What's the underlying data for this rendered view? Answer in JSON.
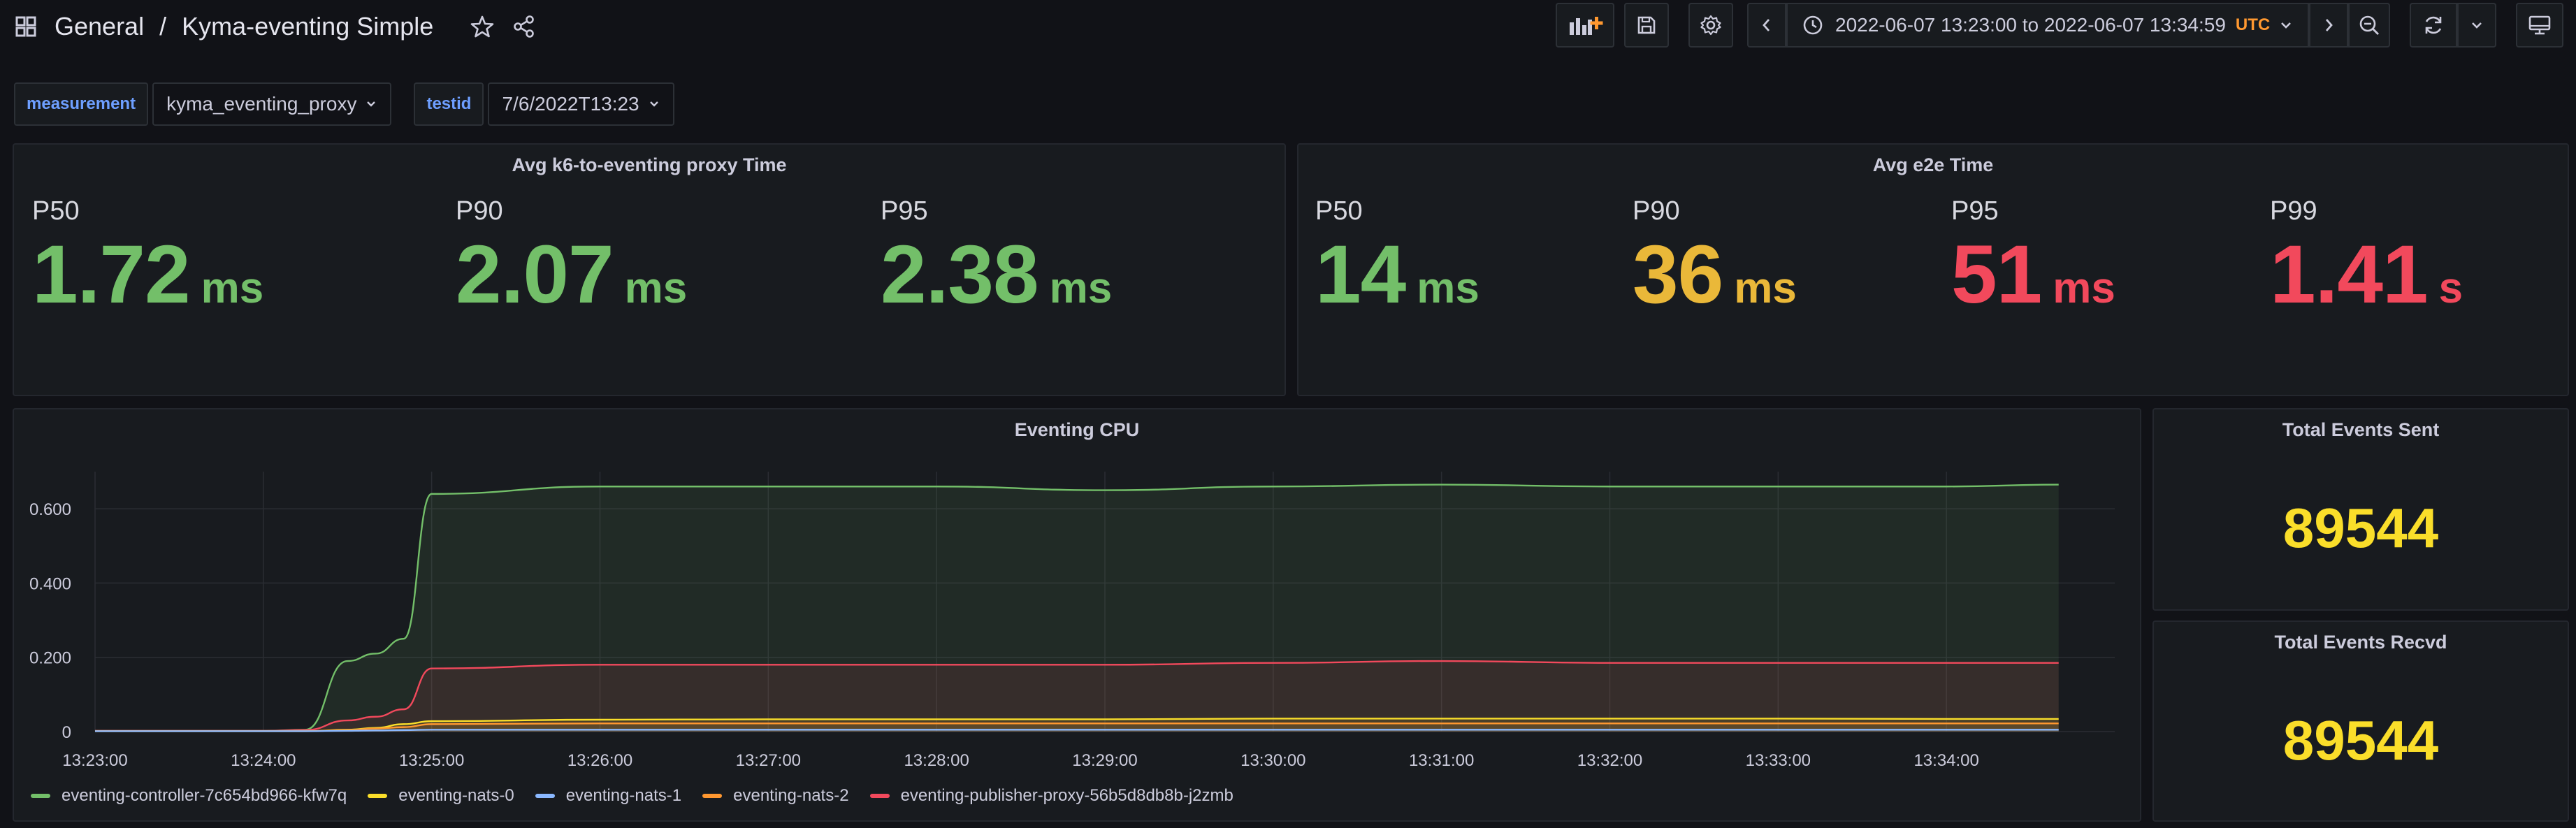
{
  "breadcrumb": {
    "folder": "General",
    "separator": "/",
    "dashboard": "Kyma-eventing Simple"
  },
  "time_picker": {
    "range": "2022-06-07 13:23:00 to 2022-06-07 13:34:59",
    "timezone": "UTC"
  },
  "icons": {
    "apps": "grid-icon",
    "star": "star-icon",
    "share": "share-icon",
    "add_panel": "add-panel-icon",
    "save": "save-icon",
    "settings": "gear-icon",
    "prev": "chevron-left-icon",
    "clock": "clock-icon",
    "next": "chevron-right-icon",
    "zoom_out": "zoom-out-icon",
    "refresh": "refresh-icon",
    "refresh_interval": "chevron-down-icon",
    "tv_mode": "monitor-icon"
  },
  "variables": [
    {
      "label": "measurement",
      "value": "kyma_eventing_proxy"
    },
    {
      "label": "testid",
      "value": "7/6/2022T13:23"
    }
  ],
  "panels": {
    "proxy_time": {
      "title": "Avg k6-to-eventing proxy Time",
      "stats": [
        {
          "label": "P50",
          "value": "1.72",
          "unit": "ms",
          "color": "#73bf69"
        },
        {
          "label": "P90",
          "value": "2.07",
          "unit": "ms",
          "color": "#73bf69"
        },
        {
          "label": "P95",
          "value": "2.38",
          "unit": "ms",
          "color": "#73bf69"
        }
      ]
    },
    "e2e_time": {
      "title": "Avg e2e Time",
      "stats": [
        {
          "label": "P50",
          "value": "14",
          "unit": "ms",
          "color": "#73bf69"
        },
        {
          "label": "P90",
          "value": "36",
          "unit": "ms",
          "color": "#eab839"
        },
        {
          "label": "P95",
          "value": "51",
          "unit": "ms",
          "color": "#f2495c"
        },
        {
          "label": "P99",
          "value": "1.41",
          "unit": "s",
          "color": "#f2495c"
        }
      ]
    },
    "events_sent": {
      "title": "Total Events Sent",
      "value": "89544",
      "color": "#fade2a"
    },
    "events_recvd": {
      "title": "Total Events Recvd",
      "value": "89544",
      "color": "#fade2a"
    }
  },
  "chart_data": {
    "type": "area",
    "title": "Eventing CPU",
    "xlabel": "",
    "ylabel": "",
    "ylim": [
      0,
      0.7
    ],
    "y_ticks": [
      "0",
      "0.200",
      "0.400",
      "0.600"
    ],
    "x_ticks": [
      "13:23:00",
      "13:24:00",
      "13:25:00",
      "13:26:00",
      "13:27:00",
      "13:28:00",
      "13:29:00",
      "13:30:00",
      "13:31:00",
      "13:32:00",
      "13:33:00",
      "13:34:00"
    ],
    "grid": true,
    "legend_position": "bottom-left",
    "x": [
      "13:23:00",
      "13:24:00",
      "13:24:15",
      "13:24:30",
      "13:24:40",
      "13:24:50",
      "13:25:00",
      "13:26:00",
      "13:27:00",
      "13:28:00",
      "13:29:00",
      "13:30:00",
      "13:31:00",
      "13:32:00",
      "13:33:00",
      "13:34:00",
      "13:34:40"
    ],
    "series": [
      {
        "name": "eventing-controller-7c654bd966-kfw7q",
        "color": "#73bf69",
        "values": [
          0.002,
          0.002,
          0.005,
          0.19,
          0.21,
          0.25,
          0.64,
          0.66,
          0.66,
          0.66,
          0.65,
          0.66,
          0.665,
          0.66,
          0.66,
          0.66,
          0.665
        ]
      },
      {
        "name": "eventing-nats-0",
        "color": "#fade2a",
        "values": [
          0.001,
          0.001,
          0.001,
          0.005,
          0.01,
          0.02,
          0.028,
          0.032,
          0.033,
          0.033,
          0.033,
          0.035,
          0.035,
          0.035,
          0.035,
          0.034,
          0.034
        ]
      },
      {
        "name": "eventing-nats-1",
        "color": "#8ab8ff",
        "values": [
          0.001,
          0.001,
          0.001,
          0.002,
          0.003,
          0.004,
          0.005,
          0.005,
          0.005,
          0.005,
          0.005,
          0.005,
          0.005,
          0.005,
          0.005,
          0.005,
          0.005
        ]
      },
      {
        "name": "eventing-nats-2",
        "color": "#ff9830",
        "values": [
          0.001,
          0.001,
          0.001,
          0.004,
          0.008,
          0.012,
          0.02,
          0.022,
          0.022,
          0.022,
          0.022,
          0.022,
          0.022,
          0.022,
          0.022,
          0.022,
          0.022
        ]
      },
      {
        "name": "eventing-publisher-proxy-56b5d8db8b-j2zmb",
        "color": "#f2495c",
        "values": [
          0.002,
          0.002,
          0.004,
          0.03,
          0.04,
          0.06,
          0.17,
          0.18,
          0.18,
          0.18,
          0.18,
          0.185,
          0.19,
          0.185,
          0.185,
          0.185,
          0.185
        ]
      }
    ]
  }
}
